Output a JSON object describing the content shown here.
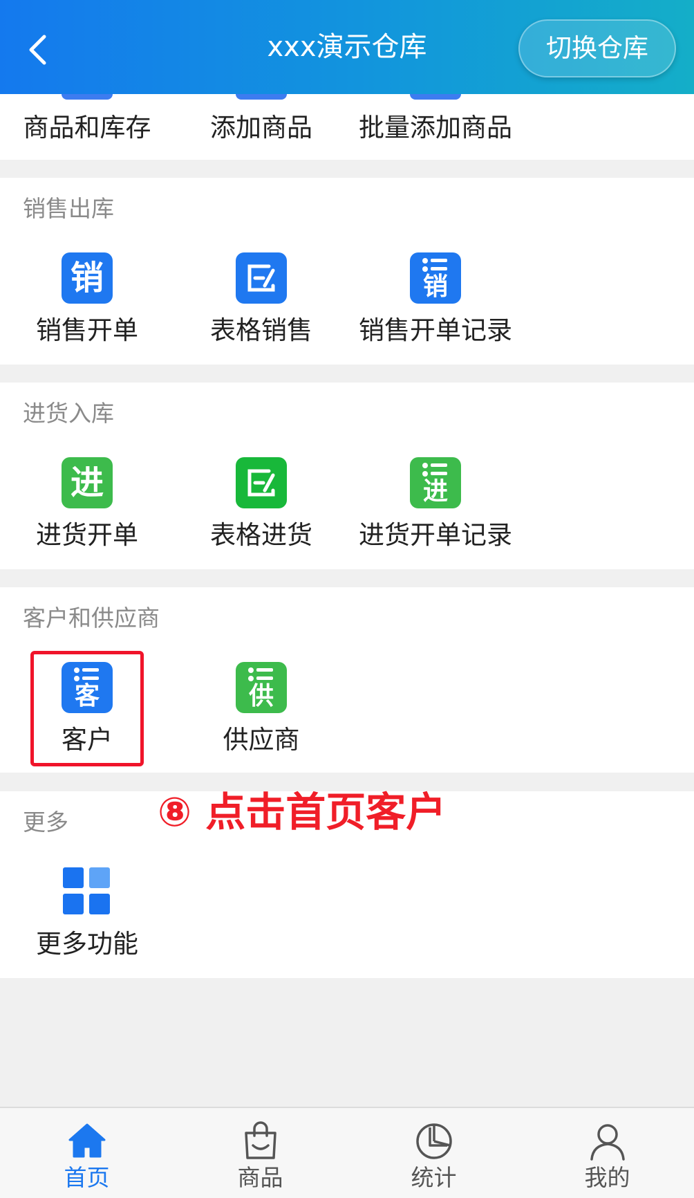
{
  "header": {
    "title": "xxx演示仓库",
    "switch_label": "切换仓库"
  },
  "top_section": {
    "items": [
      {
        "label": "商品和库存"
      },
      {
        "label": "添加商品"
      },
      {
        "label": "批量添加商品"
      }
    ]
  },
  "sales": {
    "title": "销售出库",
    "items": [
      {
        "label": "销售开单",
        "glyph": "销"
      },
      {
        "label": "表格销售"
      },
      {
        "label": "销售开单记录",
        "glyph": "销"
      }
    ]
  },
  "purchase": {
    "title": "进货入库",
    "items": [
      {
        "label": "进货开单",
        "glyph": "进"
      },
      {
        "label": "表格进货"
      },
      {
        "label": "进货开单记录",
        "glyph": "进"
      }
    ]
  },
  "partners": {
    "title": "客户和供应商",
    "items": [
      {
        "label": "客户",
        "glyph": "客"
      },
      {
        "label": "供应商",
        "glyph": "供"
      }
    ]
  },
  "more": {
    "title": "更多",
    "items": [
      {
        "label": "更多功能"
      }
    ]
  },
  "annotation": "⑧ 点击首页客户",
  "colors": {
    "accent_blue": "#1f78f0",
    "accent_green": "#3dbb4c",
    "highlight_red": "#f0142a"
  },
  "tabbar": {
    "tabs": [
      {
        "label": "首页",
        "icon": "home-icon",
        "active": true
      },
      {
        "label": "商品",
        "icon": "shopping-bag-icon"
      },
      {
        "label": "统计",
        "icon": "pie-chart-icon"
      },
      {
        "label": "我的",
        "icon": "user-icon"
      }
    ]
  }
}
